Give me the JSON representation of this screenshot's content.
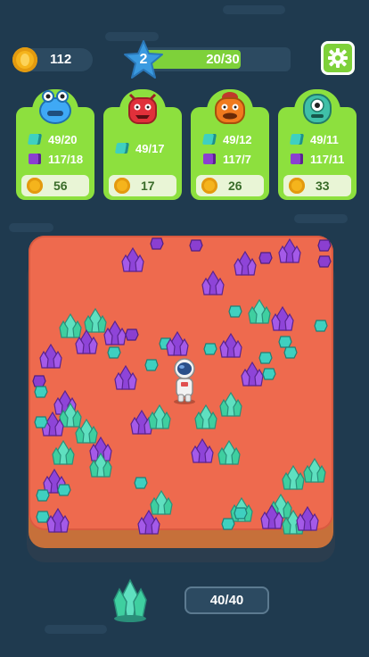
{
  "hud": {
    "coins": "112",
    "level": "2",
    "xp_text": "20/30",
    "xp_progress": 0.667,
    "settings_icon": "gear-icon"
  },
  "orders": [
    {
      "monster": "blue-monster",
      "color": "#3fa9f5",
      "cyan": "49/20",
      "purple": "117/18",
      "reward": "56"
    },
    {
      "monster": "red-monster",
      "color": "#e0303a",
      "cyan": "49/17",
      "purple": null,
      "reward": "17"
    },
    {
      "monster": "orange-monster",
      "color": "#f07a1e",
      "cyan": "49/12",
      "purple": "117/7",
      "reward": "26"
    },
    {
      "monster": "teal-monster",
      "color": "#3fc0a8",
      "cyan": "49/11",
      "purple": "117/11",
      "reward": "33"
    }
  ],
  "backpack": {
    "capacity_text": "40/40",
    "icon": "crystal-icon"
  },
  "colors": {
    "green": "#7ed13a",
    "island": "#ee6a4e",
    "background": "#1f3a4f"
  }
}
